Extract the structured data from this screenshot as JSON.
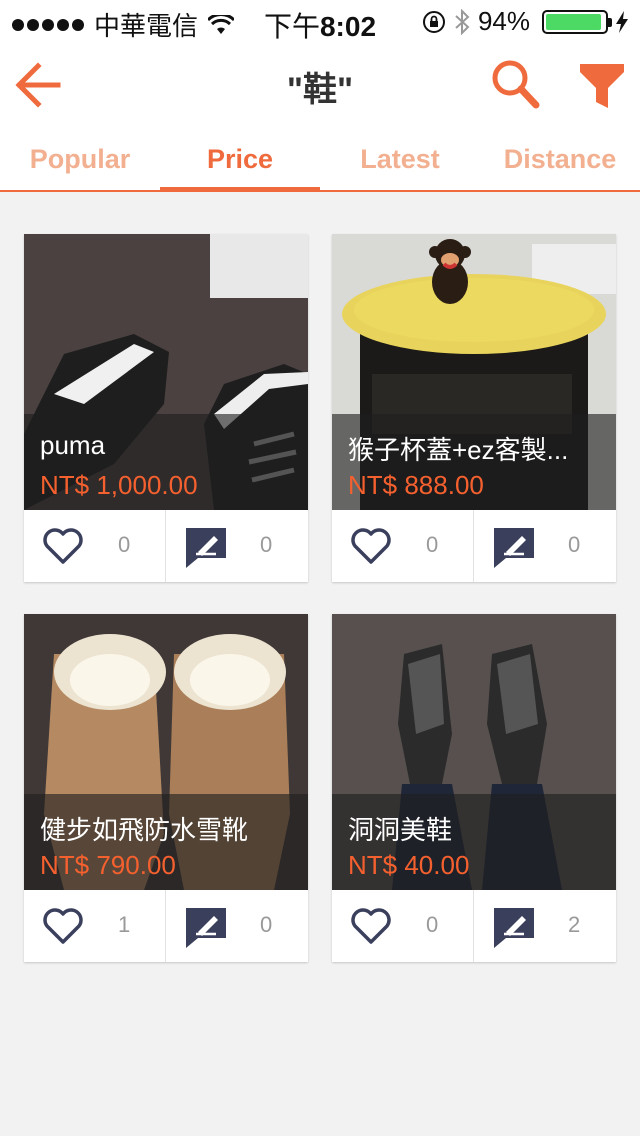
{
  "status_bar": {
    "carrier": "中華電信",
    "time_prefix": "下午",
    "time": "8:02",
    "battery": "94%",
    "battery_level": 0.94
  },
  "navbar": {
    "title": "\"鞋\""
  },
  "tabs": [
    {
      "label": "Popular",
      "active": false
    },
    {
      "label": "Price",
      "active": true
    },
    {
      "label": "Latest",
      "active": false
    },
    {
      "label": "Distance",
      "active": false
    }
  ],
  "colors": {
    "accent": "#ef6a3c",
    "price": "#f5602f",
    "icon": "#3a3f5c"
  },
  "products": [
    {
      "name": "puma",
      "price": "NT$ 1,000.00",
      "likes": "0",
      "comments": "0"
    },
    {
      "name": "猴子杯蓋+ez客製...",
      "price": "NT$ 888.00",
      "likes": "0",
      "comments": "0"
    },
    {
      "name": "健步如飛防水雪靴",
      "price": "NT$ 790.00",
      "likes": "1",
      "comments": "0"
    },
    {
      "name": "洞洞美鞋",
      "price": "NT$ 40.00",
      "likes": "0",
      "comments": "2"
    }
  ]
}
